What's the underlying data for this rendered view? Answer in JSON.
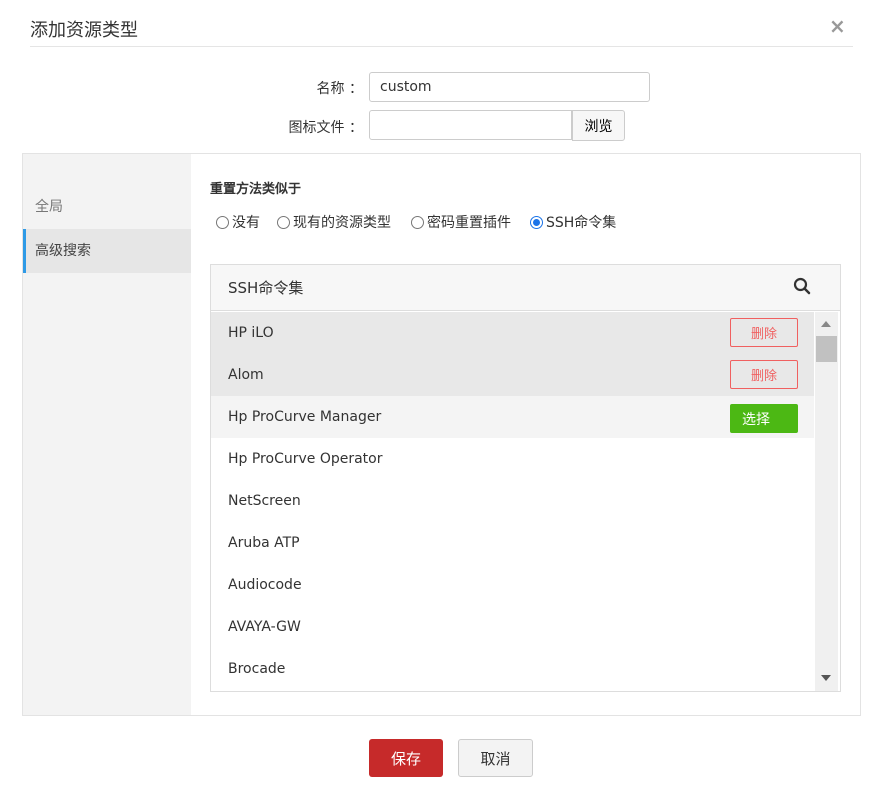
{
  "dialog": {
    "title": "添加资源类型",
    "close": "×"
  },
  "form": {
    "name_label": "名称 ：",
    "name_value": "custom",
    "icon_label": "图标文件 ：",
    "icon_value": "",
    "browse": "浏览"
  },
  "sidebar": {
    "items": [
      {
        "label": "全局"
      },
      {
        "label": "高级搜索",
        "active": true
      }
    ]
  },
  "main": {
    "section_title": "重置方法类似于",
    "radios": [
      {
        "label": "没有"
      },
      {
        "label": "现有的资源类型"
      },
      {
        "label": "密码重置插件"
      },
      {
        "label": "SSH命令集",
        "checked": true
      }
    ],
    "list": {
      "title": "SSH命令集",
      "rows": [
        {
          "name": "HP iLO",
          "action": "删除"
        },
        {
          "name": "Alom",
          "action": "删除"
        },
        {
          "name": "Hp ProCurve Manager",
          "action": "选择"
        },
        {
          "name": "Hp ProCurve Operator"
        },
        {
          "name": "NetScreen"
        },
        {
          "name": "Aruba ATP"
        },
        {
          "name": "Audiocode"
        },
        {
          "name": "AVAYA-GW"
        },
        {
          "name": "Brocade"
        }
      ]
    }
  },
  "footer": {
    "save": "保存",
    "cancel": "取消"
  },
  "colors": {
    "accent": "#2e9ae6",
    "save": "#c62a2a",
    "select": "#4cb814",
    "delete": "#f06060"
  }
}
